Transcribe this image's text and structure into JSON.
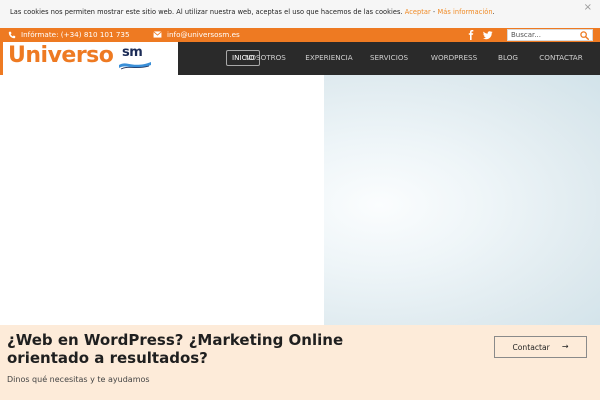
{
  "cookie_bar": {
    "message": "Las cookies nos permiten mostrar este sitio web. Al utilizar nuestra web, aceptas el uso que hacemos de las cookies.",
    "accept_label": "Aceptar",
    "separator": "-",
    "more_info_label": "Más información",
    "end_period": ".",
    "close_label": "×",
    "close_icon": "close-icon"
  },
  "contact_bar": {
    "phone_text": "Infórmate: (+34) 810 101 735",
    "email_text": "info@universosm.es",
    "phone_icon": "phone-icon",
    "mail_icon": "mail-icon",
    "social": [
      "facebook-icon",
      "twitter-icon"
    ],
    "search": {
      "placeholder": "Buscar...",
      "value": "",
      "icon": "search-icon"
    }
  },
  "header": {
    "logo": {
      "main": "Universo",
      "suffix": "sm"
    },
    "nav": [
      {
        "label": "INICIO",
        "active": true
      },
      {
        "label": "NOSOTROS",
        "active": false
      },
      {
        "label": "EXPERIENCIA",
        "active": false
      },
      {
        "label": "SERVICIOS",
        "active": false
      },
      {
        "label": "WORDPRESS",
        "active": false
      },
      {
        "label": "BLOG",
        "active": false
      },
      {
        "label": "CONTACTAR",
        "active": false
      }
    ]
  },
  "banner": {
    "title": "¿Web en WordPress? ¿Marketing Online orientado a resultados?",
    "subtitle": "Dinos qué necesitas y te ayudamos",
    "button_label": "Contactar",
    "button_arrow": "→"
  },
  "colors": {
    "accent": "#ee7a22",
    "header_bg": "#2a2a2a",
    "banner_bg": "#fdebd9",
    "logo_navy": "#1b2b56"
  }
}
